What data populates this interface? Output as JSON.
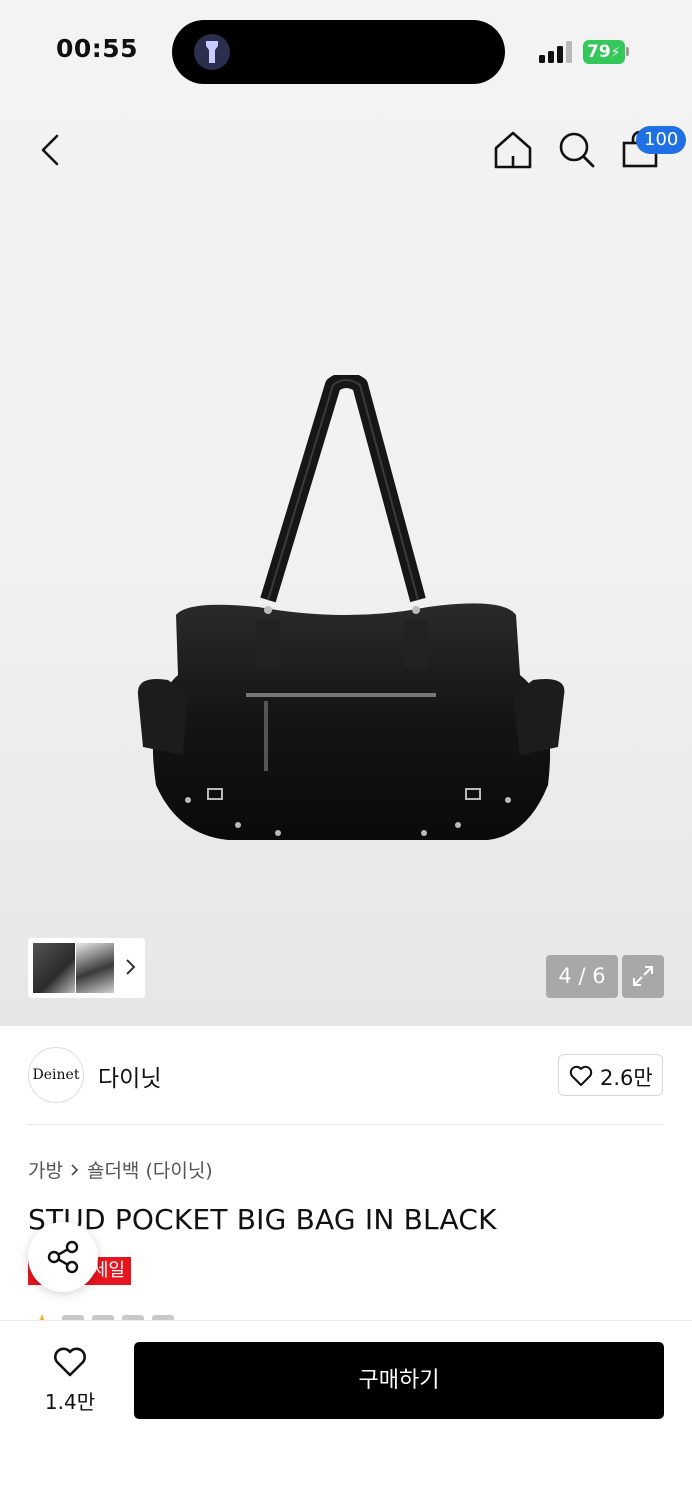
{
  "status_bar": {
    "time": "00:55",
    "battery": "79",
    "battery_color": "#34c759"
  },
  "nav": {
    "back_icon": "chevron-left-icon",
    "home_icon": "home-icon",
    "search_icon": "search-icon",
    "cart_icon": "shopping-bag-icon",
    "cart_count": "100",
    "cart_badge_color": "#1f6fe5"
  },
  "gallery": {
    "counter": "4 / 6",
    "expand_icon": "expand-icon",
    "thumbnails_chevron": "chevron-right-icon"
  },
  "brand": {
    "logo_text": "Deinet",
    "name": "다이닛",
    "likes": "2.6만"
  },
  "breadcrumb": {
    "category": "가방",
    "subcategory": "숄더백 (다이닛)"
  },
  "product": {
    "title": "STUD POCKET BIG BAG IN BLACK",
    "badge": "세일",
    "badge_color": "#e7151d"
  },
  "share": {
    "icon": "share-icon"
  },
  "bottom_bar": {
    "wish_count": "1.4만",
    "buy_label": "구매하기"
  }
}
